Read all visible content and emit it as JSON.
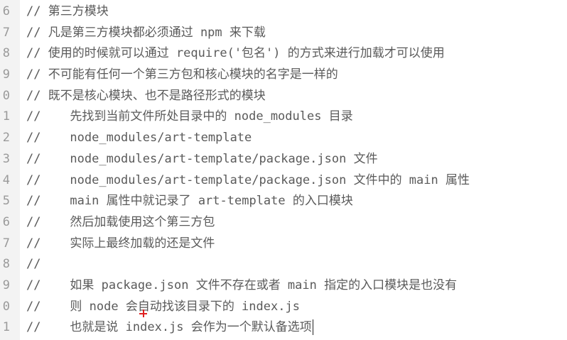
{
  "editor": {
    "lines": [
      {
        "num": "6",
        "text": "// 第三方模块"
      },
      {
        "num": "7",
        "text": "// 凡是第三方模块都必须通过 npm 来下载"
      },
      {
        "num": "8",
        "text": "// 使用的时候就可以通过 require('包名') 的方式来进行加载才可以使用"
      },
      {
        "num": "9",
        "text": "// 不可能有任何一个第三方包和核心模块的名字是一样的"
      },
      {
        "num": "0",
        "text": "// 既不是核心模块、也不是路径形式的模块"
      },
      {
        "num": "1",
        "text": "//    先找到当前文件所处目录中的 node_modules 目录"
      },
      {
        "num": "2",
        "text": "//    node_modules/art-template"
      },
      {
        "num": "3",
        "text": "//    node_modules/art-template/package.json 文件"
      },
      {
        "num": "4",
        "text": "//    node_modules/art-template/package.json 文件中的 main 属性"
      },
      {
        "num": "5",
        "text": "//    main 属性中就记录了 art-template 的入口模块"
      },
      {
        "num": "6",
        "text": "//    然后加载使用这个第三方包"
      },
      {
        "num": "7",
        "text": "//    实际上最终加载的还是文件"
      },
      {
        "num": "8",
        "text": "//"
      },
      {
        "num": "9",
        "text": "//    如果 package.json 文件不存在或者 main 指定的入口模块是也没有"
      },
      {
        "num": "0",
        "text": "//    则 node 会自动找该目录下的 index.js"
      },
      {
        "num": "1",
        "text": "//    也就是说 index.js 会作为一个默认备选项"
      }
    ]
  }
}
